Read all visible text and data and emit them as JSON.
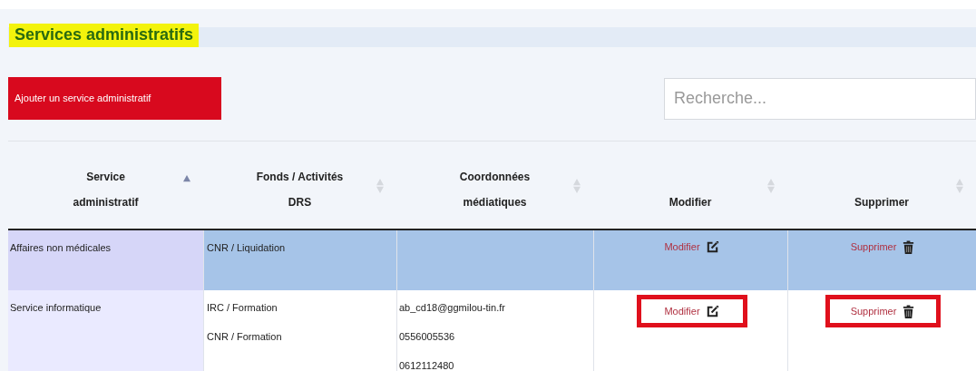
{
  "title": {
    "text": "Services administratifs",
    "highlighted": true
  },
  "add_button": "Ajouter un service administratif",
  "search": {
    "placeholder": "Recherche..."
  },
  "table": {
    "columns": [
      {
        "lines": [
          "Service",
          "administratif"
        ],
        "sorted_ascending": true
      },
      {
        "lines": [
          "Fonds / Activités",
          "DRS"
        ],
        "sorted_ascending": false
      },
      {
        "lines": [
          "Coordonnées",
          "médiatiques"
        ],
        "sorted_ascending": false
      },
      {
        "lines": [
          "Modifier"
        ],
        "sorted_ascending": false
      },
      {
        "lines": [
          "Supprimer"
        ],
        "sorted_ascending": false
      }
    ],
    "rows": [
      {
        "selected": true,
        "service": "Affaires non médicales",
        "funds": [
          "CNR / Liquidation"
        ],
        "contacts": [],
        "edit": {
          "label": "Modifier",
          "circled": false
        },
        "delete": {
          "label": "Supprimer",
          "circled": false
        }
      },
      {
        "selected": false,
        "service": "Service informatique",
        "funds": [
          "IRC / Formation",
          "CNR / Formation"
        ],
        "contacts": [
          "ab_cd18@ggmilou-tin.fr",
          "0556005536",
          "0612112480"
        ],
        "edit": {
          "label": "Modifier",
          "circled": true
        },
        "delete": {
          "label": "Supprimer",
          "circled": true
        }
      }
    ]
  }
}
